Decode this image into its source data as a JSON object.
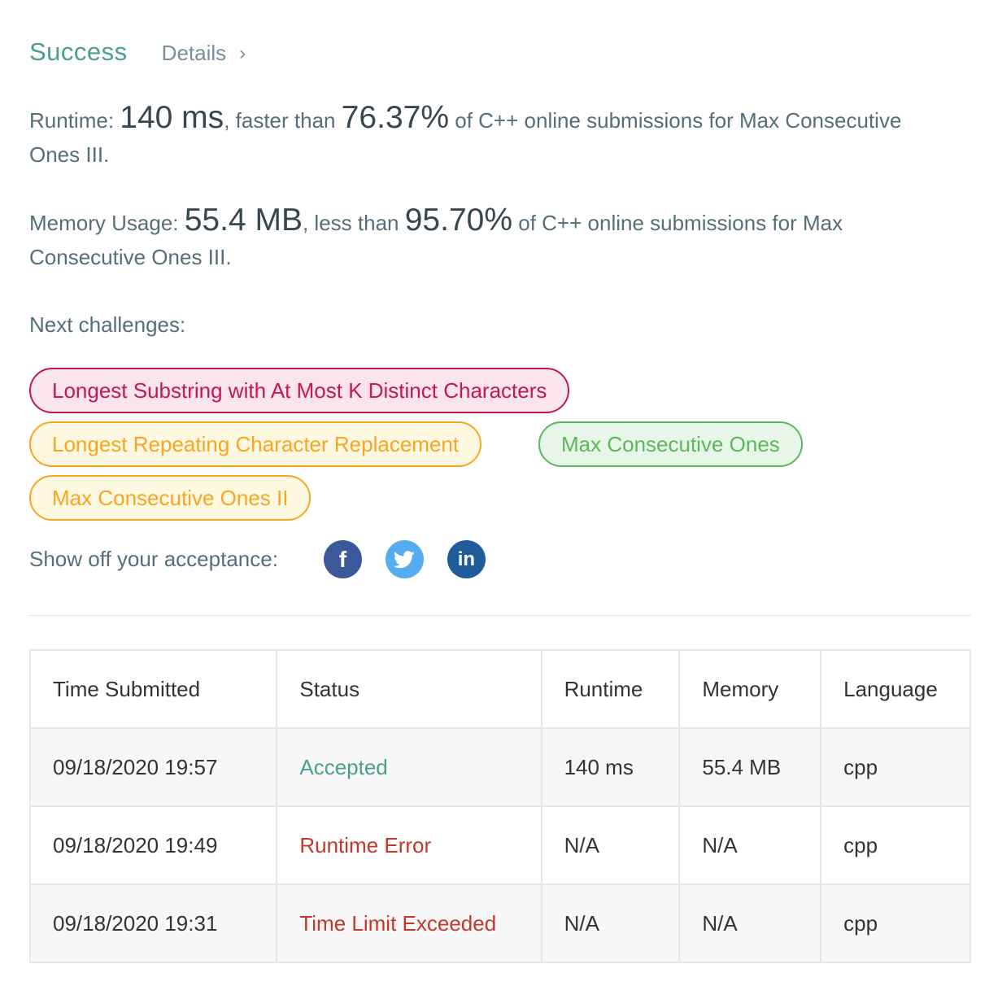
{
  "header": {
    "status": "Success",
    "details_label": "Details",
    "chevron": "›"
  },
  "runtime": {
    "label": "Runtime:",
    "value": "140 ms",
    "mid": ", faster than",
    "percent": "76.37%",
    "suffix": "of C++ online submissions for Max Consecutive Ones III."
  },
  "memory": {
    "label": "Memory Usage:",
    "value": "55.4 MB",
    "mid": ", less than",
    "percent": "95.70%",
    "suffix": "of C++ online submissions for Max Consecutive Ones III."
  },
  "next": {
    "label": "Next challenges:",
    "challenges": [
      {
        "title": "Longest Substring with At Most K Distinct Characters",
        "difficulty": "hard"
      },
      {
        "title": "Longest Repeating Character Replacement",
        "difficulty": "medium"
      },
      {
        "title": "Max Consecutive Ones",
        "difficulty": "easy"
      },
      {
        "title": "Max Consecutive Ones II",
        "difficulty": "medium"
      }
    ]
  },
  "share": {
    "label": "Show off your acceptance:",
    "icons": [
      "facebook-icon",
      "twitter-icon",
      "linkedin-icon"
    ],
    "fb_glyph": "f",
    "li_glyph": "in"
  },
  "table": {
    "headers": [
      "Time Submitted",
      "Status",
      "Runtime",
      "Memory",
      "Language"
    ],
    "rows": [
      {
        "time": "09/18/2020 19:57",
        "status": "Accepted",
        "runtime": "140 ms",
        "memory": "55.4 MB",
        "language": "cpp"
      },
      {
        "time": "09/18/2020 19:49",
        "status": "Runtime Error",
        "runtime": "N/A",
        "memory": "N/A",
        "language": "cpp"
      },
      {
        "time": "09/18/2020 19:31",
        "status": "Time Limit Exceeded",
        "runtime": "N/A",
        "memory": "N/A",
        "language": "cpp"
      }
    ]
  },
  "colors": {
    "success": "#4a9e8f",
    "hard": "#c2185b",
    "medium": "#f5a623",
    "easy": "#5cb85c",
    "error": "#c0392b"
  }
}
